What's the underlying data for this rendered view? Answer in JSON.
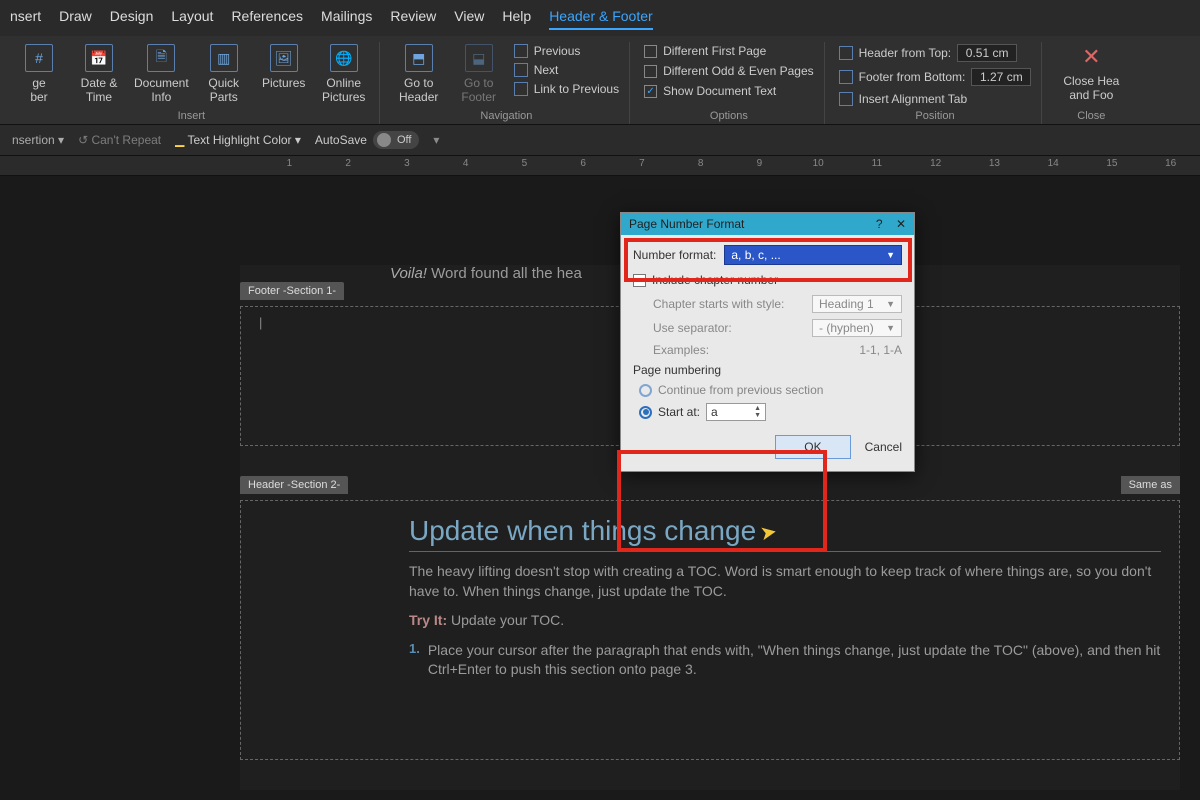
{
  "tabs": [
    "nsert",
    "Draw",
    "Design",
    "Layout",
    "References",
    "Mailings",
    "Review",
    "View",
    "Help",
    "Header & Footer"
  ],
  "active_tab": "Header & Footer",
  "ribbon": {
    "insert_group": {
      "label": "Insert",
      "btn_page_number": "ge\nber",
      "btn_date_time": "Date &\nTime",
      "btn_doc_info": "Document\nInfo",
      "btn_quick_parts": "Quick\nParts",
      "btn_pictures": "Pictures",
      "btn_online_pics": "Online\nPictures"
    },
    "nav_group": {
      "label": "Navigation",
      "btn_goto_header": "Go to\nHeader",
      "btn_goto_footer": "Go to\nFooter",
      "row_previous": "Previous",
      "row_next": "Next",
      "row_link": "Link to Previous"
    },
    "options_group": {
      "label": "Options",
      "chk_first": "Different First Page",
      "chk_oddeven": "Different Odd & Even Pages",
      "chk_showdoc": "Show Document Text"
    },
    "position_group": {
      "label": "Position",
      "row_top": "Header from Top:",
      "val_top": "0.51 cm",
      "row_bottom": "Footer from Bottom:",
      "val_bottom": "1.27 cm",
      "row_align": "Insert Alignment Tab"
    },
    "close_group": {
      "label": "Close",
      "btn_close": "Close Hea\nand Foo"
    }
  },
  "qat": {
    "insertion": "nsertion",
    "cant_repeat": "Can't Repeat",
    "highlight": "Text Highlight Color",
    "autosave": "AutoSave",
    "autosave_state": "Off"
  },
  "doc": {
    "voila_line_prefix": "Voila!",
    "voila_line_rest": " Word found all the hea",
    "footer_label": "Footer -Section 1-",
    "header_label": "Header -Section 2-",
    "same_as": "Same as",
    "h2": "Update when things change",
    "para1": "The heavy lifting doesn't stop with creating a TOC. Word is smart enough to keep track of where things are, so you don't have to. When things change, just update the TOC.",
    "tryit_label": "Try It:",
    "tryit_text": " Update your TOC.",
    "list1_num": "1.",
    "list1": "Place your cursor after the paragraph that ends with, \"When things change, just update the TOC\" (above), and then hit Ctrl+Enter to push this section onto page 3."
  },
  "dialog": {
    "title": "Page Number Format",
    "help": "?",
    "close": "✕",
    "lbl_format": "Number format:",
    "format_value": "a, b, c, ...",
    "chk_chapter": "Include chapter number",
    "lbl_starts": "Chapter starts with style:",
    "val_starts": "Heading 1",
    "lbl_sep": "Use separator:",
    "val_sep": "- (hyphen)",
    "lbl_examples": "Examples:",
    "val_examples": "1-1, 1-A",
    "lbl_pagenum": "Page numbering",
    "radio_continue": "Continue from previous section",
    "radio_start": "Start at:",
    "val_start": "a",
    "ok": "OK",
    "cancel": "Cancel"
  },
  "ruler_numbers": [
    "1",
    "2",
    "3",
    "4",
    "5",
    "6",
    "7",
    "8",
    "9",
    "10",
    "11",
    "12",
    "13",
    "14",
    "15",
    "16"
  ]
}
